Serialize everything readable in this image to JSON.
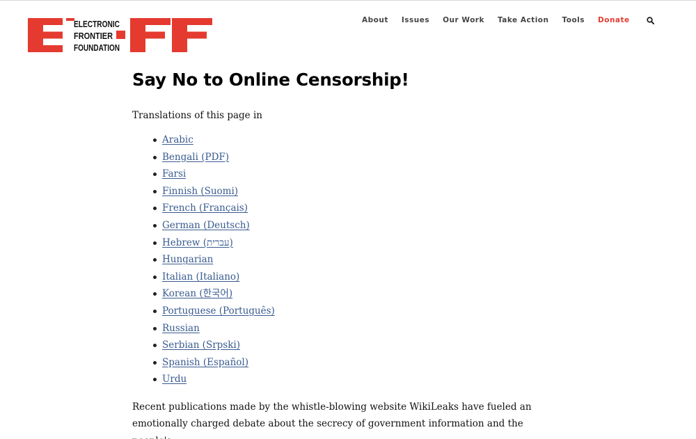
{
  "logo": {
    "text_lines": [
      "ELECTRONIC",
      "FRONTIER",
      "FOUNDATION"
    ],
    "brand_color": "#e53a2f"
  },
  "nav": {
    "items": [
      "About",
      "Issues",
      "Our Work",
      "Take Action",
      "Tools"
    ],
    "donate": "Donate",
    "search_icon": "search-icon"
  },
  "page": {
    "title": "Say No to Online Censorship!",
    "intro": "Translations of this page in",
    "languages": [
      "Arabic",
      "Bengali (PDF)",
      "Farsi",
      "Finnish (Suomi)",
      "French (Français)",
      "German (Deutsch)",
      "Hebrew (עברית)",
      "Hungarian",
      "Italian (Italiano)",
      "Korean (한국어)",
      "Portuguese (Português)",
      "Russian",
      "Serbian (Srpski)",
      "Spanish (Español)",
      "Urdu"
    ],
    "body_lines": [
      "Recent publications made by the whistle-blowing website WikiLeaks have fueled an",
      "emotionally charged debate about the secrecy of government information and the people's"
    ]
  },
  "colors": {
    "link": "#385a8f",
    "accent": "#e53a2f",
    "nav_text": "#444444"
  }
}
